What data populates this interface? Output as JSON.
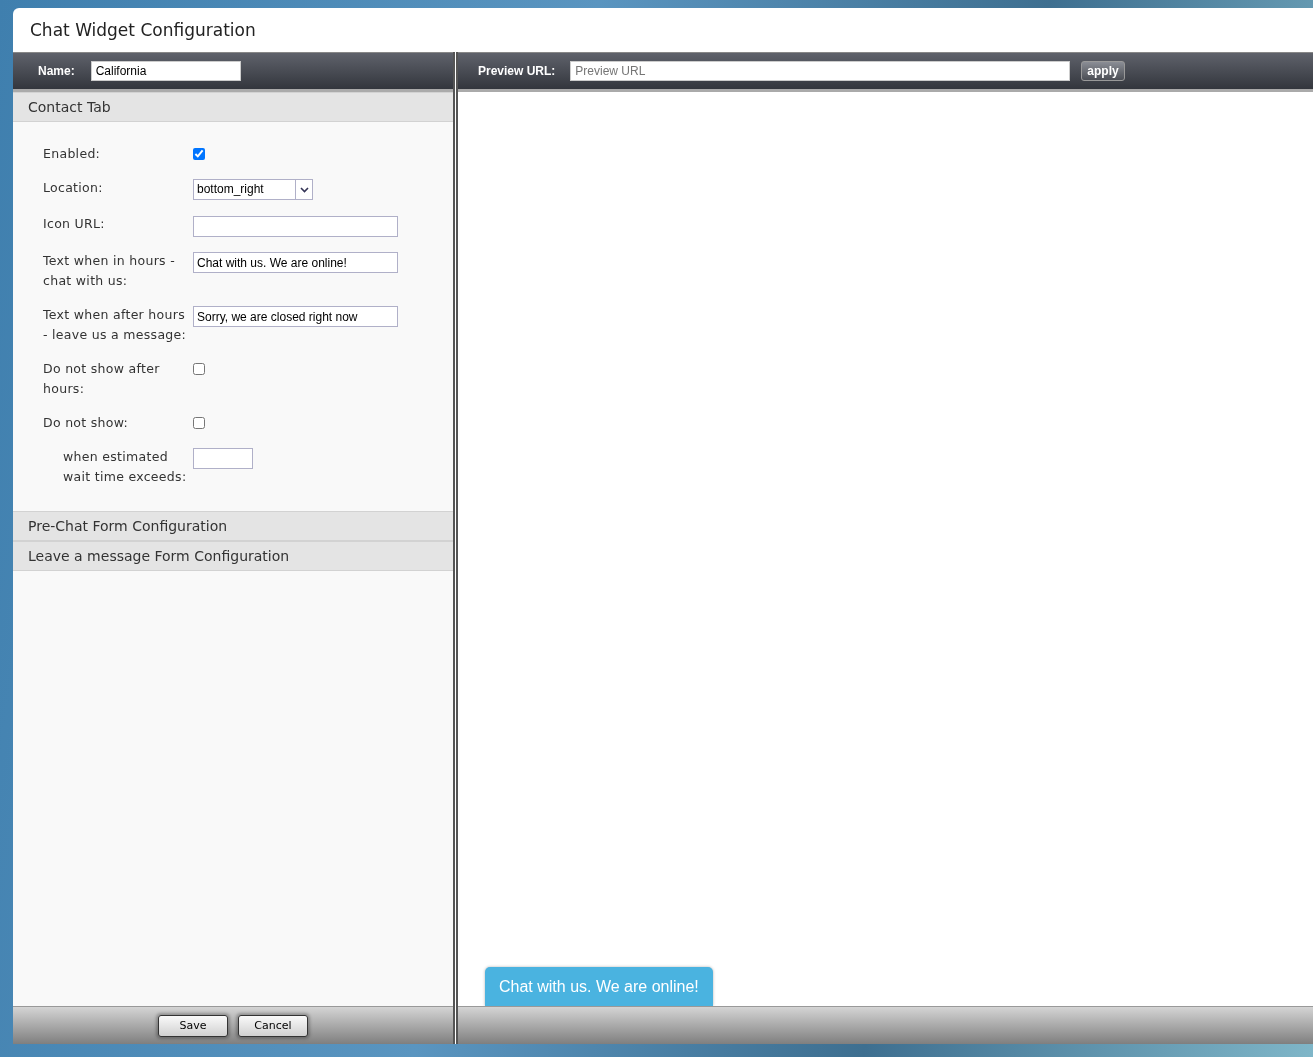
{
  "window": {
    "title": "Chat Widget Configuration"
  },
  "name_bar": {
    "label": "Name:",
    "value": "California"
  },
  "preview_bar": {
    "label": "Preview URL:",
    "placeholder": "Preview URL",
    "button": "apply"
  },
  "sections": [
    {
      "title": "Contact Tab",
      "expanded": true,
      "fields": [
        {
          "kind": "checkbox",
          "label": "Enabled:",
          "checked": true
        },
        {
          "kind": "select",
          "label": "Location:",
          "value": "bottom_right"
        },
        {
          "kind": "text",
          "label": "Icon URL:"
        },
        {
          "kind": "text",
          "label": "Text when in hours - chat with us:",
          "value": "Chat with us. We are online!"
        },
        {
          "kind": "text",
          "label": "Text when after hours - leave us a message:",
          "value": "Sorry, we are closed right now"
        },
        {
          "kind": "checkbox",
          "label": "Do not show after hours:",
          "checked": false
        },
        {
          "kind": "checkbox",
          "label": "Do not show:",
          "checked": false
        },
        {
          "kind": "short",
          "label": "when estimated wait time exceeds:"
        }
      ]
    },
    {
      "title": "Pre-Chat Form Configuration",
      "expanded": false
    },
    {
      "title": "Leave a message Form Configuration",
      "expanded": false
    }
  ],
  "footer_buttons": [
    "Save",
    "Cancel"
  ],
  "preview": {
    "chat_tab": "Chat with us. We are online!"
  }
}
